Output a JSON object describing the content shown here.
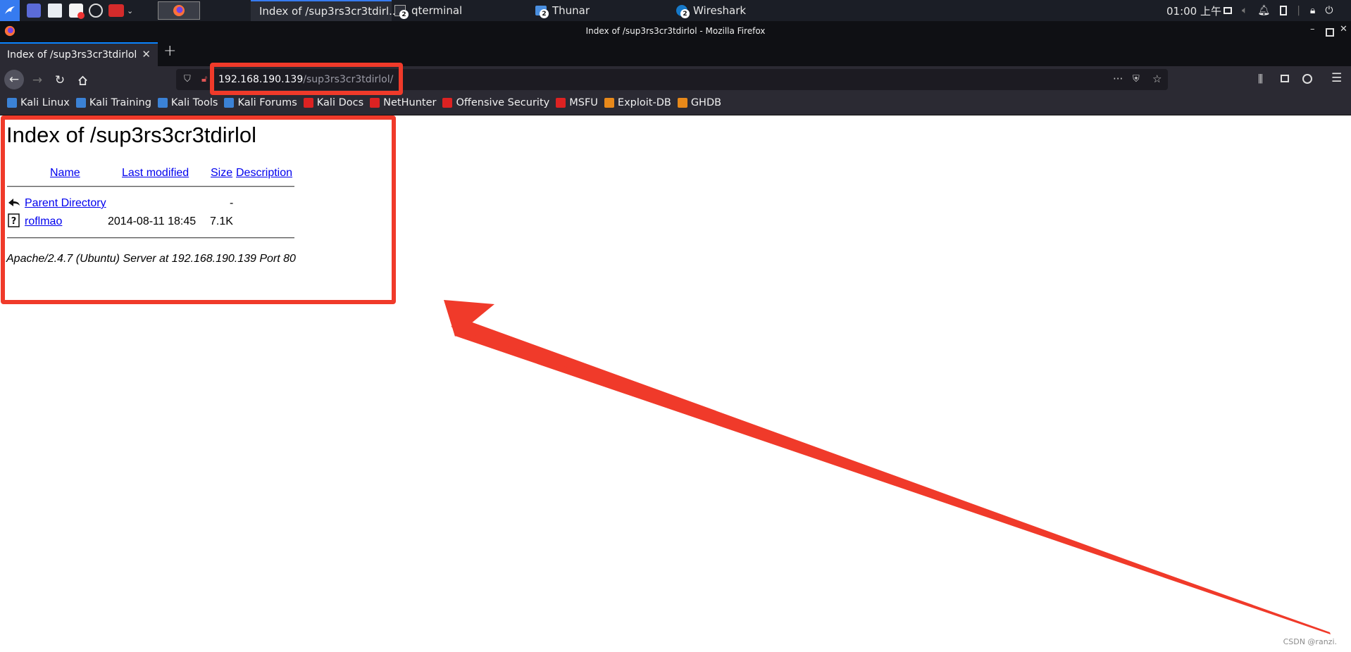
{
  "taskbar": {
    "tasks": [
      {
        "label": "Index of /sup3rs3cr3tdirl...",
        "icon": "firefox-icon"
      },
      {
        "label": "qterminal",
        "icon": "terminal-icon",
        "badge": "2"
      },
      {
        "label": "Thunar",
        "icon": "folder-icon",
        "badge": "2"
      },
      {
        "label": "Wireshark",
        "icon": "wireshark-icon",
        "badge": "2"
      }
    ],
    "clock": "01:00 上午"
  },
  "window": {
    "title": "Index of /sup3rs3cr3tdirlol - Mozilla Firefox"
  },
  "tab": {
    "label": "Index of /sup3rs3cr3tdirlol",
    "close": "✕",
    "new_tab": "+"
  },
  "urlbar": {
    "host": "192.168.190.139",
    "path": "/sup3rs3cr3tdirlol/"
  },
  "bookmarks": [
    {
      "label": "Kali Linux",
      "icon": "kali-icon",
      "color": "#3b82d6"
    },
    {
      "label": "Kali Training",
      "icon": "kali-icon",
      "color": "#3b82d6"
    },
    {
      "label": "Kali Tools",
      "icon": "kali-icon",
      "color": "#3b82d6"
    },
    {
      "label": "Kali Forums",
      "icon": "kali-icon",
      "color": "#3b82d6"
    },
    {
      "label": "Kali Docs",
      "icon": "kali-docs-icon",
      "color": "#d22"
    },
    {
      "label": "NetHunter",
      "icon": "nethunter-icon",
      "color": "#d22"
    },
    {
      "label": "Offensive Security",
      "icon": "offsec-icon",
      "color": "#d22"
    },
    {
      "label": "MSFU",
      "icon": "offsec-icon",
      "color": "#d22"
    },
    {
      "label": "Exploit-DB",
      "icon": "exploitdb-icon",
      "color": "#e8891a"
    },
    {
      "label": "GHDB",
      "icon": "exploitdb-icon",
      "color": "#e8891a"
    }
  ],
  "page": {
    "heading": "Index of /sup3rs3cr3tdirlol",
    "columns": {
      "name": "Name",
      "last_modified": "Last modified",
      "size": "Size",
      "description": "Description"
    },
    "rows": [
      {
        "name": "Parent Directory",
        "modified": "",
        "size": "-",
        "icon": "back-arrow-icon"
      },
      {
        "name": "roflmao",
        "modified": "2014-08-11 18:45",
        "size": "7.1K",
        "icon": "unknown-file-icon"
      }
    ],
    "address": "Apache/2.4.7 (Ubuntu) Server at 192.168.190.139 Port 80"
  },
  "watermark": "CSDN @ranzi.",
  "colors": {
    "annotation": "#f03a2a",
    "link": "#0000ee",
    "accent": "#0a84ff"
  }
}
